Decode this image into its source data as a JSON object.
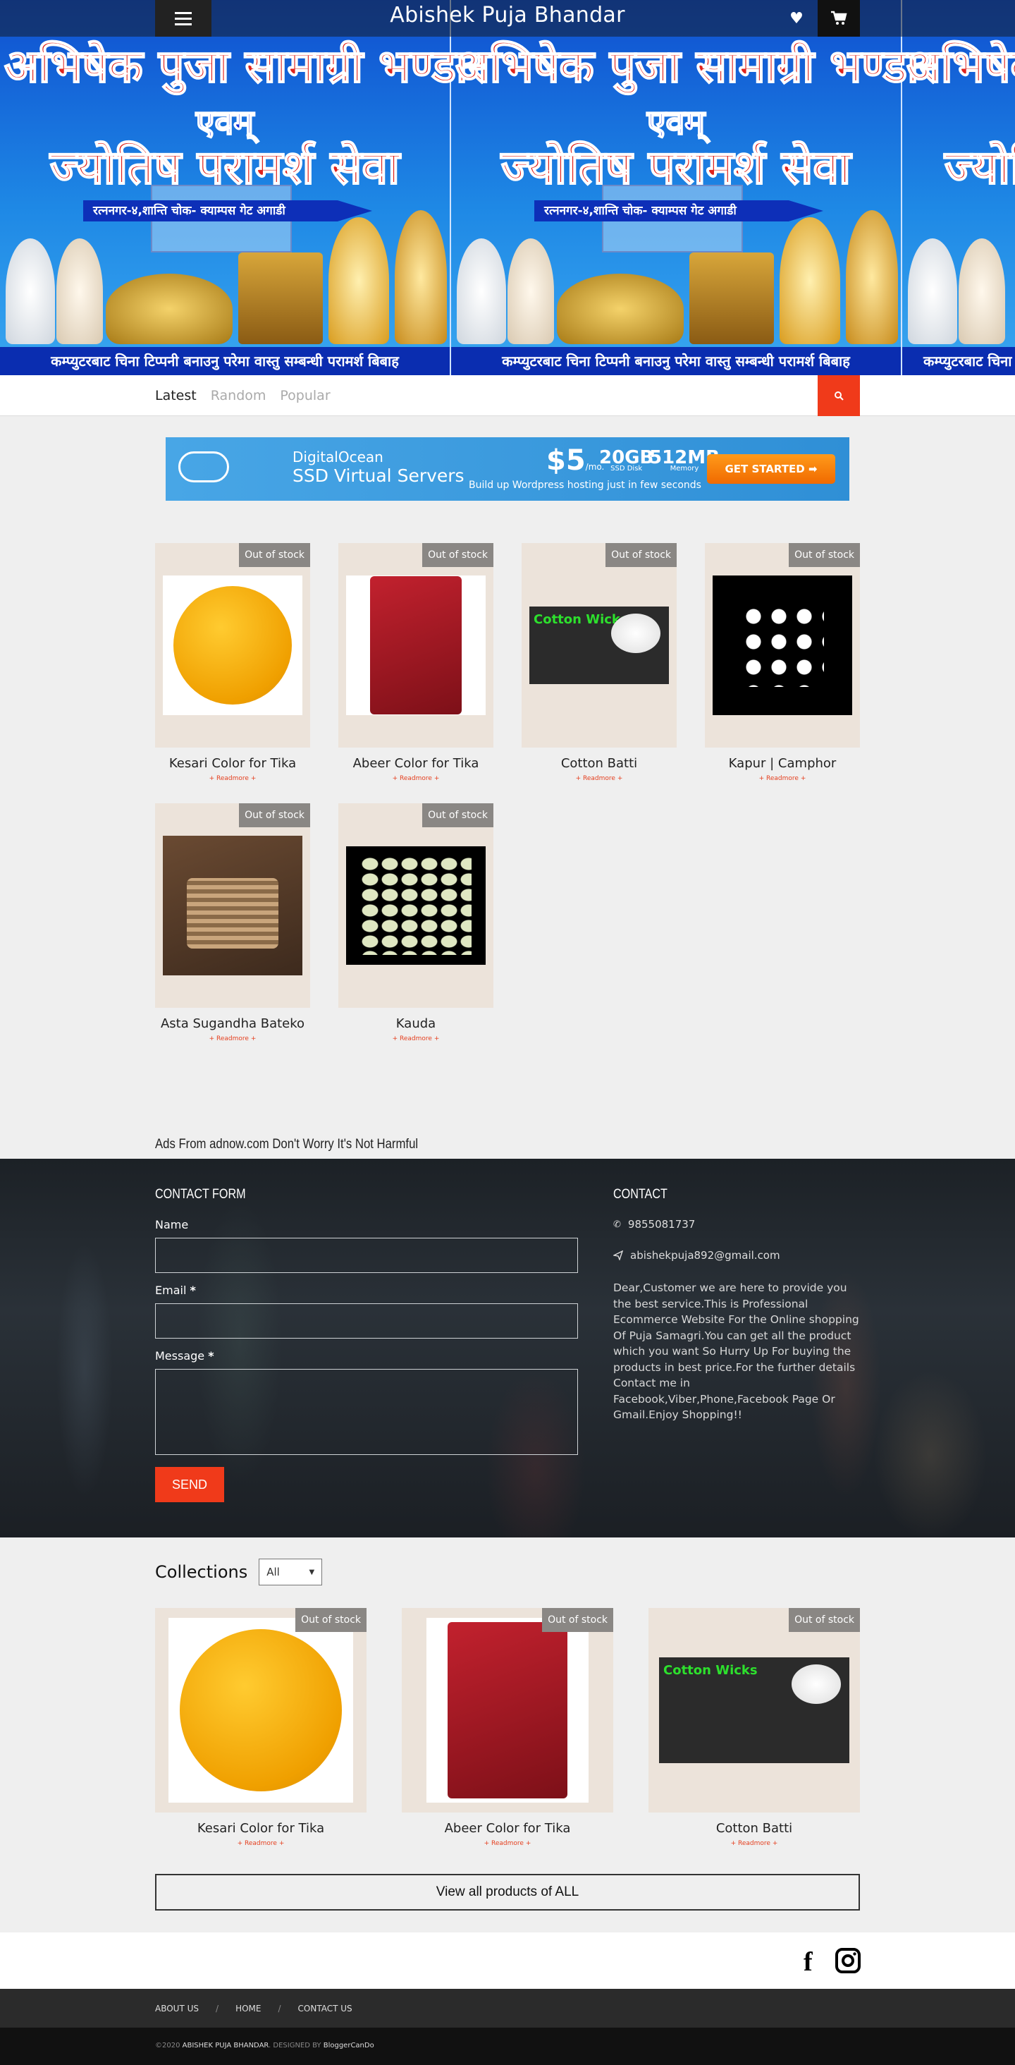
{
  "header": {
    "title": "Abishek Puja Bhandar",
    "menu_icon": "hamburger-icon",
    "wishlist_icon": "heart-icon",
    "cart_icon": "cart-icon"
  },
  "banner": {
    "line1": "अभिषेक पुजा सामाग्री भण्डार",
    "line2": "एवम्",
    "line3": "ज्योतिष परामर्श सेवा",
    "address": "रत्ननगर-४,शान्ति चोक- क्याम्पस गेट अगाडी",
    "strip": "कम्प्युटरबाट चिना टिप्पनी बनाउनु परेमा वास्तु सम्बन्धी परामर्श बिबाह"
  },
  "tabs": [
    "Latest",
    "Random",
    "Popular"
  ],
  "search_icon": "search-icon",
  "ad": {
    "brand": "DigitalOcean",
    "product": "SSD Virtual Servers",
    "price": "$5",
    "price_unit": "/mo.",
    "disk": "20GB",
    "disk_label": "SSD Disk",
    "memory": "512MB",
    "memory_label": "Memory",
    "tagline": "Build up Wordpress hosting just in few seconds",
    "cta": "GET STARTED"
  },
  "products": [
    {
      "name": "Kesari Color for Tika",
      "badge": "Out of stock",
      "more": "+ Readmore +"
    },
    {
      "name": "Abeer Color for Tika",
      "badge": "Out of stock",
      "more": "+ Readmore +"
    },
    {
      "name": "Cotton Batti",
      "badge": "Out of stock",
      "more": "+ Readmore +"
    },
    {
      "name": "Kapur | Camphor",
      "badge": "Out of stock",
      "more": "+ Readmore +"
    },
    {
      "name": "Asta Sugandha Bateko",
      "badge": "Out of stock",
      "more": "+ Readmore +"
    },
    {
      "name": "Kauda",
      "badge": "Out of stock",
      "more": "+ Readmore +"
    }
  ],
  "adnow_text": "Ads From adnow.com Don't Worry It's Not Harmful",
  "contact_form": {
    "title": "CONTACT FORM",
    "name_label": "Name",
    "email_label": "Email",
    "message_label": "Message",
    "required_mark": "*",
    "send": "SEND"
  },
  "contact": {
    "title": "CONTACT",
    "phone": "9855081737",
    "email": "abishekpuja892@gmail.com",
    "description": "Dear,Customer we are here to provide you the best service.This is Professional Ecommerce Website For the Online shopping Of Puja Samagri.You can get all the product which you want So Hurry Up For buying the products in best price.For the further details Contact me in Facebook,Viber,Phone,Facebook Page Or Gmail.Enjoy Shopping!!"
  },
  "collections": {
    "title": "Collections",
    "select_value": "All",
    "items": [
      {
        "name": "Kesari Color for Tika",
        "badge": "Out of stock",
        "more": "+ Readmore +"
      },
      {
        "name": "Abeer Color for Tika",
        "badge": "Out of stock",
        "more": "+ Readmore +"
      },
      {
        "name": "Cotton Batti",
        "badge": "Out of stock",
        "more": "+ Readmore +"
      }
    ],
    "view_all": "View all products of ALL"
  },
  "social": {
    "facebook": "f",
    "instagram_icon": "instagram-icon"
  },
  "footer_nav": [
    "ABOUT US",
    "HOME",
    "CONTACT US"
  ],
  "footer_sep": "/",
  "copyright": {
    "year": "©2020",
    "site": "ABISHEK PUJA BHANDAR",
    "designed_by": ". DESIGNED BY",
    "designer": "BloggerCanDo"
  },
  "colors": {
    "accent": "#f03a1a",
    "dark": "#2b2b2b",
    "badge": "#8a8784",
    "card_bg": "#ece3da"
  }
}
